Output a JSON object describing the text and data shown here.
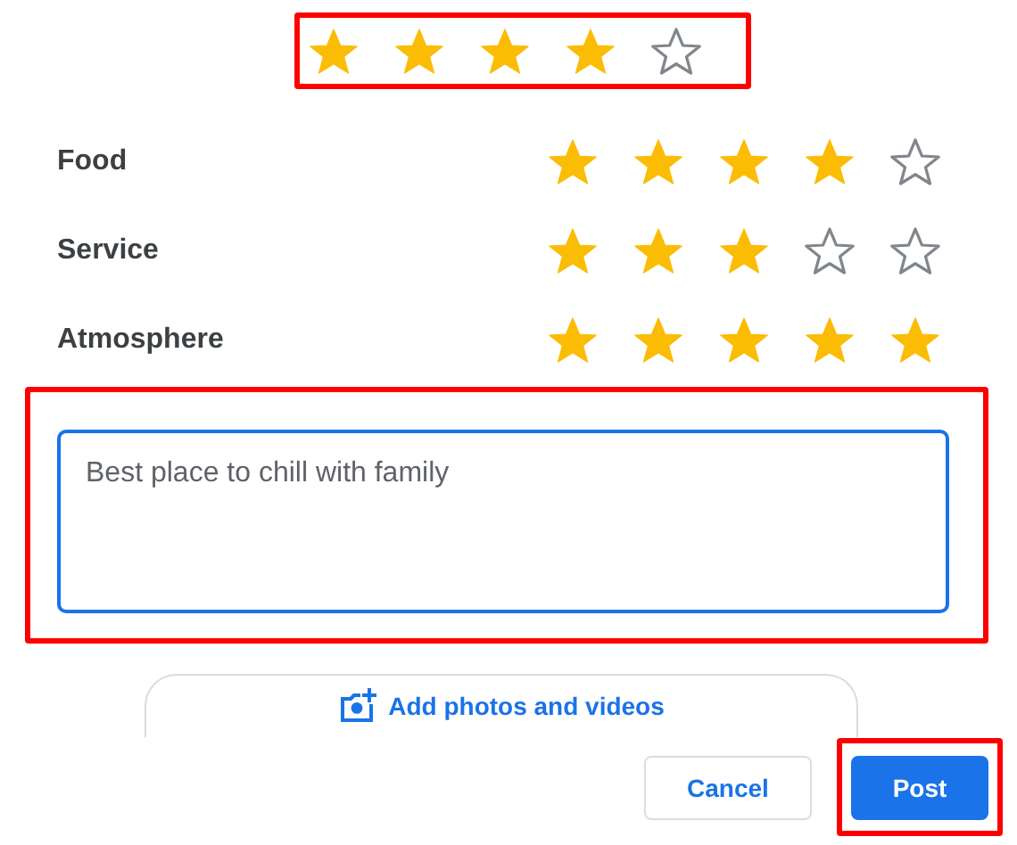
{
  "overall": {
    "stars": 4,
    "highlighted": true
  },
  "categories": [
    {
      "label": "Food",
      "stars": 4
    },
    {
      "label": "Service",
      "stars": 3
    },
    {
      "label": "Atmosphere",
      "stars": 5
    }
  ],
  "review": {
    "placeholder": "Best place to chill with family",
    "highlighted": true
  },
  "media_button": {
    "label": "Add photos and videos"
  },
  "actions": [
    {
      "label": "Cancel",
      "kind": "secondary",
      "highlighted": false
    },
    {
      "label": "Post",
      "kind": "primary",
      "highlighted": true
    }
  ]
}
